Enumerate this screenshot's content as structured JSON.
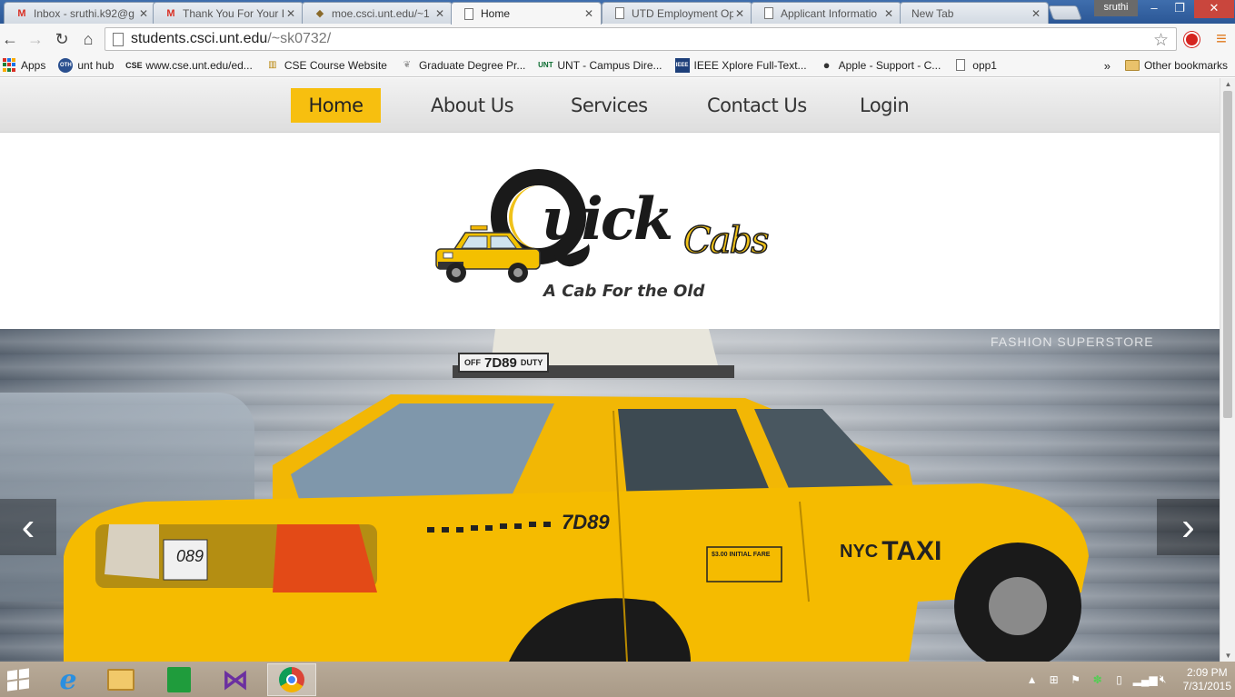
{
  "browser": {
    "tabs": [
      {
        "title": "Inbox - sruthi.k92@g",
        "icon": "gmail-icon",
        "active": false
      },
      {
        "title": "Thank You For Your I",
        "icon": "gmail-icon",
        "active": false
      },
      {
        "title": "moe.csci.unt.edu/~1",
        "icon": "shield-icon",
        "active": false
      },
      {
        "title": "Home",
        "icon": "page-icon",
        "active": true
      },
      {
        "title": "UTD Employment Op",
        "icon": "page-icon",
        "active": false
      },
      {
        "title": "Applicant Informatio",
        "icon": "page-icon",
        "active": false
      },
      {
        "title": "New Tab",
        "icon": "none",
        "active": false
      }
    ],
    "profile_name": "sruthi",
    "url_host": "students.csci.unt.edu",
    "url_path": "/~sk0732/",
    "bookmarks": [
      {
        "label": "Apps",
        "icon": "apps-grid-icon"
      },
      {
        "label": "unt hub",
        "icon": "unt-hub-icon"
      },
      {
        "label": "www.cse.unt.edu/ed...",
        "icon": "cse-icon"
      },
      {
        "label": "CSE Course Website",
        "icon": "course-icon"
      },
      {
        "label": "Graduate Degree Pr...",
        "icon": "feather-icon"
      },
      {
        "label": "UNT - Campus Dire...",
        "icon": "unt-icon"
      },
      {
        "label": "IEEE Xplore Full-Text...",
        "icon": "ieee-icon"
      },
      {
        "label": "Apple - Support - C...",
        "icon": "apple-icon"
      },
      {
        "label": "opp1",
        "icon": "page-icon"
      }
    ],
    "more_bookmarks": "»",
    "other_bookmarks": "Other bookmarks"
  },
  "site": {
    "nav": [
      {
        "label": "Home",
        "active": true
      },
      {
        "label": "About Us",
        "active": false
      },
      {
        "label": "Services",
        "active": false
      },
      {
        "label": "Contact Us",
        "active": false
      },
      {
        "label": "Login",
        "active": false
      }
    ],
    "logo": {
      "word1": "uick",
      "word2": "Cabs",
      "tagline": "A Cab For the Old"
    },
    "hero": {
      "taxi_sign": "7D89",
      "taxi_sign_left": "OFF",
      "taxi_sign_right": "DUTY",
      "taxi_number": "7D89",
      "plate": "089",
      "door_brand": "NYC",
      "door_brand2": "TAXI",
      "fare_sign": "$3.00 INITIAL FARE",
      "storefront": "FASHION SUPERSTORE",
      "prev_label": "‹",
      "next_label": "›"
    }
  },
  "taskbar": {
    "apps": [
      "windows-start-icon",
      "internet-explorer-icon",
      "file-explorer-icon",
      "windows-store-icon",
      "visual-studio-icon",
      "chrome-icon"
    ],
    "time": "2:09 PM",
    "date": "7/31/2015"
  },
  "colors": {
    "accent": "#f7bf0f",
    "taxi_yellow": "#f2b705",
    "chrome_tab_bar": "#2b5796"
  }
}
